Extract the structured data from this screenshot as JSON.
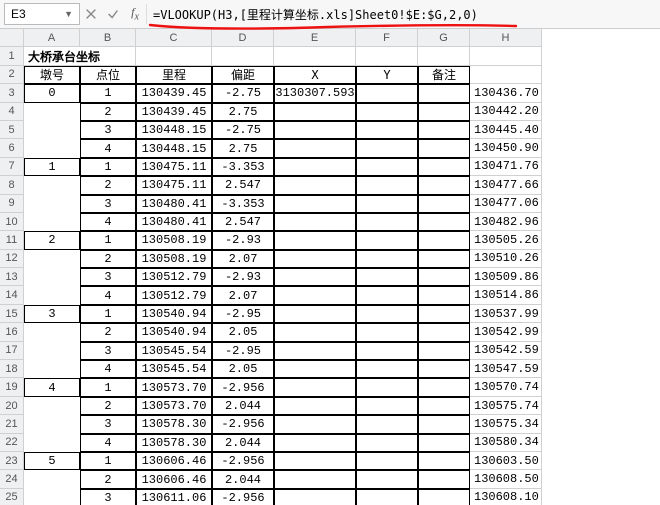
{
  "formula_bar": {
    "cell_ref": "E3",
    "formula": "=VLOOKUP(H3,[里程计算坐标.xls]Sheet0!$E:$G,2,0)"
  },
  "columns": [
    "A",
    "B",
    "C",
    "D",
    "E",
    "F",
    "G",
    "H"
  ],
  "row_numbers": [
    1,
    2,
    3,
    4,
    5,
    6,
    7,
    8,
    9,
    10,
    11,
    12,
    13,
    14,
    15,
    16,
    17,
    18,
    19,
    20,
    21,
    22,
    23,
    24,
    25
  ],
  "title": "大桥承台坐标",
  "headers": {
    "A": "墩号",
    "B": "点位",
    "C": "里程",
    "D": "偏距",
    "E": "X",
    "F": "Y",
    "G": "备注"
  },
  "blocks": [
    {
      "mark": "0",
      "rows": [
        {
          "b": "1",
          "c": "130439.45",
          "d": "-2.75",
          "e": "3130307.593",
          "h": "130436.70"
        },
        {
          "b": "2",
          "c": "130439.45",
          "d": "2.75",
          "e": "",
          "h": "130442.20"
        },
        {
          "b": "3",
          "c": "130448.15",
          "d": "-2.75",
          "e": "",
          "h": "130445.40"
        },
        {
          "b": "4",
          "c": "130448.15",
          "d": "2.75",
          "e": "",
          "h": "130450.90"
        }
      ]
    },
    {
      "mark": "1",
      "rows": [
        {
          "b": "1",
          "c": "130475.11",
          "d": "-3.353",
          "e": "",
          "h": "130471.76"
        },
        {
          "b": "2",
          "c": "130475.11",
          "d": "2.547",
          "e": "",
          "h": "130477.66"
        },
        {
          "b": "3",
          "c": "130480.41",
          "d": "-3.353",
          "e": "",
          "h": "130477.06"
        },
        {
          "b": "4",
          "c": "130480.41",
          "d": "2.547",
          "e": "",
          "h": "130482.96"
        }
      ]
    },
    {
      "mark": "2",
      "rows": [
        {
          "b": "1",
          "c": "130508.19",
          "d": "-2.93",
          "e": "",
          "h": "130505.26"
        },
        {
          "b": "2",
          "c": "130508.19",
          "d": "2.07",
          "e": "",
          "h": "130510.26"
        },
        {
          "b": "3",
          "c": "130512.79",
          "d": "-2.93",
          "e": "",
          "h": "130509.86"
        },
        {
          "b": "4",
          "c": "130512.79",
          "d": "2.07",
          "e": "",
          "h": "130514.86"
        }
      ]
    },
    {
      "mark": "3",
      "rows": [
        {
          "b": "1",
          "c": "130540.94",
          "d": "-2.95",
          "e": "",
          "h": "130537.99"
        },
        {
          "b": "2",
          "c": "130540.94",
          "d": "2.05",
          "e": "",
          "h": "130542.99"
        },
        {
          "b": "3",
          "c": "130545.54",
          "d": "-2.95",
          "e": "",
          "h": "130542.59"
        },
        {
          "b": "4",
          "c": "130545.54",
          "d": "2.05",
          "e": "",
          "h": "130547.59"
        }
      ]
    },
    {
      "mark": "4",
      "rows": [
        {
          "b": "1",
          "c": "130573.70",
          "d": "-2.956",
          "e": "",
          "h": "130570.74"
        },
        {
          "b": "2",
          "c": "130573.70",
          "d": "2.044",
          "e": "",
          "h": "130575.74"
        },
        {
          "b": "3",
          "c": "130578.30",
          "d": "-2.956",
          "e": "",
          "h": "130575.34"
        },
        {
          "b": "4",
          "c": "130578.30",
          "d": "2.044",
          "e": "",
          "h": "130580.34"
        }
      ]
    },
    {
      "mark": "5",
      "rows": [
        {
          "b": "1",
          "c": "130606.46",
          "d": "-2.956",
          "e": "",
          "h": "130603.50"
        },
        {
          "b": "2",
          "c": "130606.46",
          "d": "2.044",
          "e": "",
          "h": "130608.50"
        },
        {
          "b": "3",
          "c": "130611.06",
          "d": "-2.956",
          "e": "",
          "h": "130608.10"
        }
      ]
    }
  ]
}
